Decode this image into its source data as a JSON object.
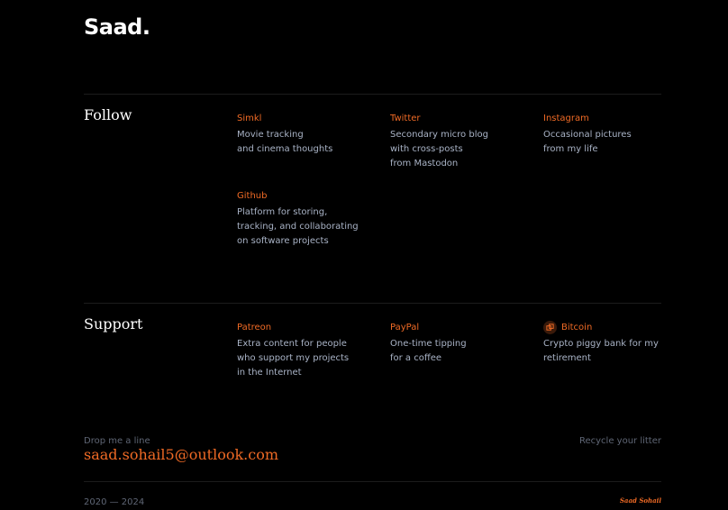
{
  "header": {
    "logo": "Saad."
  },
  "follow": {
    "title": "Follow",
    "items": [
      {
        "title": "Simkl",
        "desc": [
          "Movie tracking",
          "and cinema thoughts"
        ]
      },
      {
        "title": "Twitter",
        "desc": [
          "Secondary micro blog",
          "with cross-posts",
          "from Mastodon"
        ]
      },
      {
        "title": "Instagram",
        "desc": [
          "Occasional pictures",
          "from my life"
        ]
      },
      {
        "title": "Github",
        "desc": [
          "Platform for storing,",
          "tracking, and collaborating",
          "on software projects"
        ]
      }
    ]
  },
  "support": {
    "title": "Support",
    "items": [
      {
        "title": "Patreon",
        "desc": [
          "Extra content for people",
          "who support my projects",
          "in the Internet"
        ]
      },
      {
        "title": "PayPal",
        "desc": [
          "One-time tipping",
          "for a coffee"
        ]
      },
      {
        "title": "Bitcoin",
        "icon": "bitcoin-icon",
        "desc": [
          "Crypto piggy bank for my",
          "retirement"
        ]
      }
    ]
  },
  "footer": {
    "drop_label": "Drop me a line",
    "email": "saad.sohail5@outlook.com",
    "recycle": "Recycle your litter",
    "years": "2020 — 2024",
    "signature": "Saad Sohail"
  },
  "colors": {
    "background": "#000000",
    "accent": "#ef6a25",
    "text_muted": "#a9b3c6",
    "text_dim": "#5f6675"
  }
}
